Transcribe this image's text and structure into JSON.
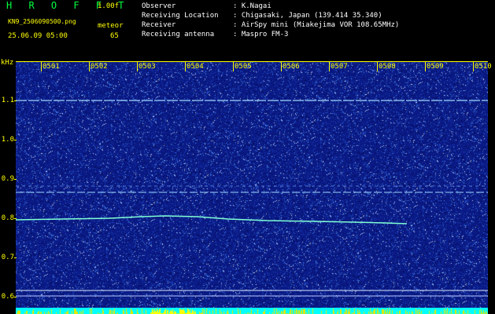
{
  "header": {
    "logo": "HROFFT",
    "version": "1.00f",
    "filename": "KN9_2506090500.png",
    "datetime": "25.06.09 05:00",
    "meteor_label": "meteor",
    "meteor_count": "65"
  },
  "info": {
    "observer": {
      "label": "Observer",
      "value": ": K.Nagai"
    },
    "location": {
      "label": "Receiving Location",
      "value": ": Chigasaki, Japan (139.414 35.340)"
    },
    "receiver": {
      "label": "Receiver",
      "value": ": AirSpy mini (Miakejima VOR 108.65MHz)"
    },
    "antenna": {
      "label": "Receiving antenna",
      "value": ": Maspro FM-3"
    }
  },
  "axes": {
    "y_unit": "kHz",
    "y_ticks": [
      "1.1",
      "1.0",
      "0.9",
      "0.8",
      "0.7",
      "0.6"
    ],
    "x_ticks": [
      "0501",
      "0502",
      "0503",
      "0504",
      "0505",
      "0506",
      "0507",
      "0508",
      "0509",
      "0510"
    ]
  },
  "colors": {
    "background": "#0a1a86",
    "text": "#ffff00",
    "trace": "#7fffd4",
    "logo": "#00ff40"
  }
}
